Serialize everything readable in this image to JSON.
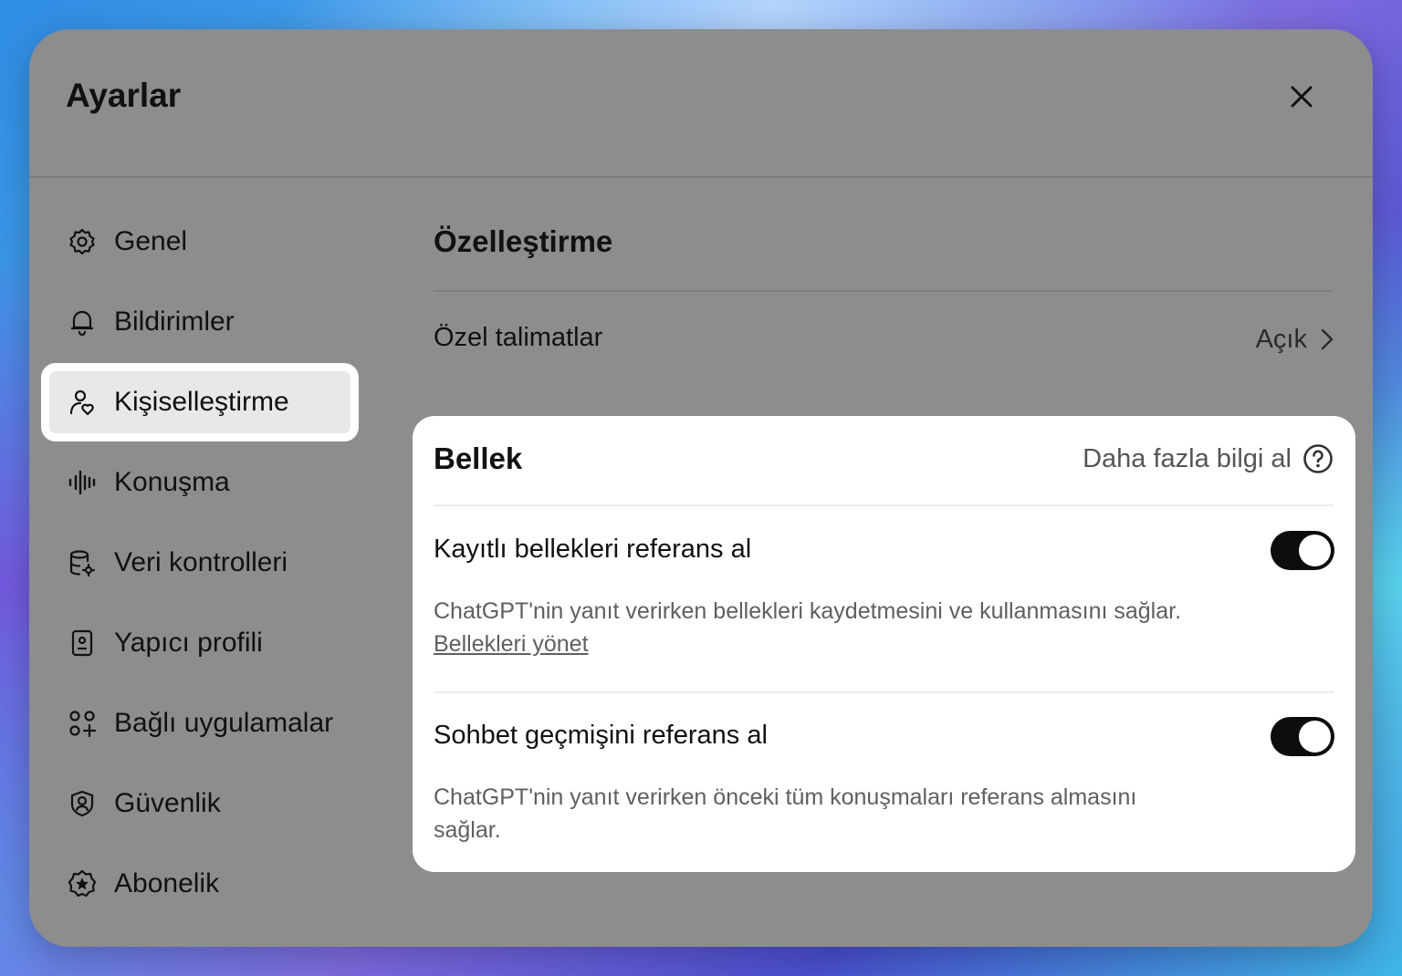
{
  "dialog": {
    "title": "Ayarlar"
  },
  "sidebar": {
    "items": [
      {
        "label": "Genel",
        "icon": "gear-icon"
      },
      {
        "label": "Bildirimler",
        "icon": "bell-icon"
      },
      {
        "label": "Kişiselleştirme",
        "icon": "person-heart-icon",
        "active": true
      },
      {
        "label": "Konuşma",
        "icon": "waveform-icon"
      },
      {
        "label": "Veri kontrolleri",
        "icon": "database-gear-icon"
      },
      {
        "label": "Yapıcı profili",
        "icon": "id-badge-icon"
      },
      {
        "label": "Bağlı uygulamalar",
        "icon": "apps-grid-icon"
      },
      {
        "label": "Güvenlik",
        "icon": "shield-user-icon"
      },
      {
        "label": "Abonelik",
        "icon": "star-badge-icon"
      }
    ]
  },
  "main": {
    "section_title": "Özelleştirme",
    "custom_instructions": {
      "label": "Özel talimatlar",
      "value": "Açık"
    },
    "memory": {
      "title": "Bellek",
      "learn_more": "Daha fazla bilgi al",
      "saved_memories": {
        "label": "Kayıtlı bellekleri referans al",
        "enabled": true,
        "description": "ChatGPT'nin yanıt verirken bellekleri kaydetmesini ve kullanmasını sağlar.",
        "link": "Bellekleri yönet"
      },
      "chat_history": {
        "label": "Sohbet geçmişini referans al",
        "enabled": true,
        "description": "ChatGPT'nin yanıt verirken önceki tüm konuşmaları referans almasını sağlar."
      }
    }
  },
  "colors": {
    "dialog_bg": "#8d8d8d",
    "card_bg": "#ffffff",
    "toggle_on": "#0d0d0d",
    "active_item_bg": "#e8e8e8"
  }
}
